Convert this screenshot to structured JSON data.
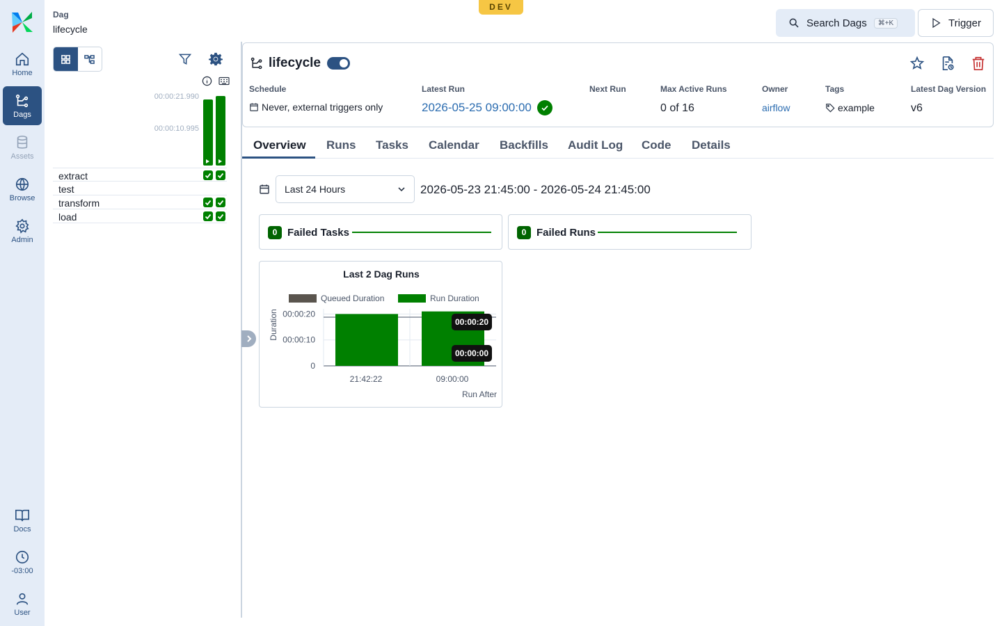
{
  "nav": {
    "items": [
      {
        "label": "Home",
        "icon": "home-icon"
      },
      {
        "label": "Dags",
        "icon": "dags-icon"
      },
      {
        "label": "Assets",
        "icon": "database-icon"
      },
      {
        "label": "Browse",
        "icon": "globe-icon"
      },
      {
        "label": "Admin",
        "icon": "gear-icon"
      },
      {
        "label": "Docs",
        "icon": "book-icon"
      },
      {
        "label": "-03:00",
        "icon": "clock-icon"
      },
      {
        "label": "User",
        "icon": "user-icon"
      }
    ]
  },
  "breadcrumb": {
    "section": "Dag",
    "name": "lifecycle"
  },
  "env": "DEV",
  "header": {
    "search_label": "Search Dags",
    "search_shortcut": "⌘+K",
    "trigger_label": "Trigger"
  },
  "grid": {
    "duration_ticks": [
      "00:00:21.990",
      "00:00:10.995"
    ],
    "runs": [
      {
        "fill": 0.95
      },
      {
        "fill": 1.0
      }
    ],
    "tasks": [
      {
        "name": "extract",
        "states": [
          "success",
          "success"
        ]
      },
      {
        "name": "test",
        "states": []
      },
      {
        "name": "transform",
        "states": [
          "success",
          "success"
        ]
      },
      {
        "name": "load",
        "states": [
          "success",
          "success"
        ]
      }
    ]
  },
  "dag": {
    "title": "lifecycle",
    "schedule_label": "Schedule",
    "schedule_value": "Never, external triggers only",
    "latest_run_label": "Latest Run",
    "latest_run_value": "2026-05-25 09:00:00",
    "next_run_label": "Next Run",
    "max_active_label": "Max Active Runs",
    "max_active_value": "0 of 16",
    "owner_label": "Owner",
    "owner_value": "airflow",
    "tags_label": "Tags",
    "tags_value": "example",
    "version_label": "Latest Dag Version",
    "version_value": "v6"
  },
  "tabs": [
    "Overview",
    "Runs",
    "Tasks",
    "Calendar",
    "Backfills",
    "Audit Log",
    "Code",
    "Details"
  ],
  "overview": {
    "range_select": "Last 24 Hours",
    "range_text": "2026-05-23 21:45:00 - 2026-05-24 21:45:00",
    "failed_tasks": {
      "count": "0",
      "label": "Failed Tasks"
    },
    "failed_runs": {
      "count": "0",
      "label": "Failed Runs"
    }
  },
  "chart_data": {
    "type": "bar",
    "title": "Last 2 Dag Runs",
    "xlabel": "Run After",
    "ylabel": "Duration",
    "categories": [
      "21:42:22",
      "09:00:00"
    ],
    "y_ticks": [
      "0",
      "00:00:10",
      "00:00:20"
    ],
    "ylim": [
      0,
      22
    ],
    "series": [
      {
        "name": "Queued Duration",
        "color": "#5a554e",
        "values": [
          0,
          0
        ]
      },
      {
        "name": "Run Duration",
        "color": "#008000",
        "values": [
          20,
          21
        ]
      }
    ],
    "tooltips": [
      "00:00:20",
      "00:00:00"
    ],
    "legend": "top"
  }
}
